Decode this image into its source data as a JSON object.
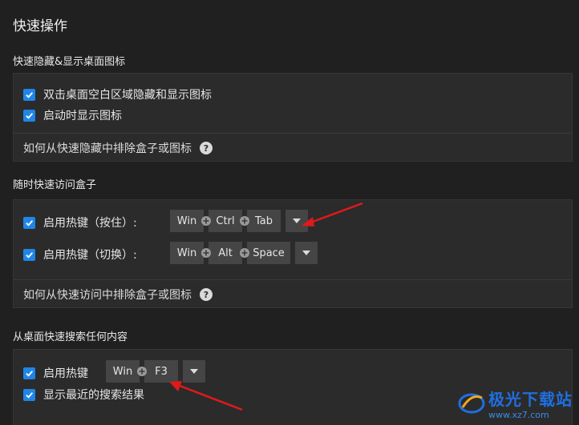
{
  "page": {
    "title": "快速操作"
  },
  "quick_hide": {
    "title": "快速隐藏&显示桌面图标",
    "options": [
      {
        "label": "双击桌面空白区域隐藏和显示图标",
        "checked": true
      },
      {
        "label": "启动时显示图标",
        "checked": true
      }
    ],
    "help_link": "如何从快速隐藏中排除盒子或图标"
  },
  "quick_access": {
    "title": "随时快速访问盒子",
    "hotkey_hold": {
      "label": "启用热键（按住）:",
      "checked": true,
      "keys": [
        "Win",
        "Ctrl",
        "Tab"
      ]
    },
    "hotkey_toggle": {
      "label": "启用热键（切换）:",
      "checked": true,
      "keys": [
        "Win",
        "Alt",
        "Space"
      ]
    },
    "help_link": "如何从快速访问中排除盒子或图标"
  },
  "desktop_search": {
    "title": "从桌面快速搜索任何内容",
    "hotkey": {
      "label": "启用热键",
      "checked": true,
      "keys": [
        "Win",
        "F3"
      ]
    },
    "recent": {
      "label": "显示最近的搜索结果",
      "checked": true
    }
  },
  "colors": {
    "background": "#202020",
    "panel": "#2b2b2b",
    "checkbox": "#1f86e8",
    "annotation_arrow": "#e0191b"
  },
  "icons": {
    "checkbox": "check-icon",
    "help": "help-icon",
    "plus": "plus-icon",
    "dropdown": "chevron-down-icon"
  },
  "watermark": {
    "text": "极光下载站",
    "url": "www.xz7.com"
  }
}
